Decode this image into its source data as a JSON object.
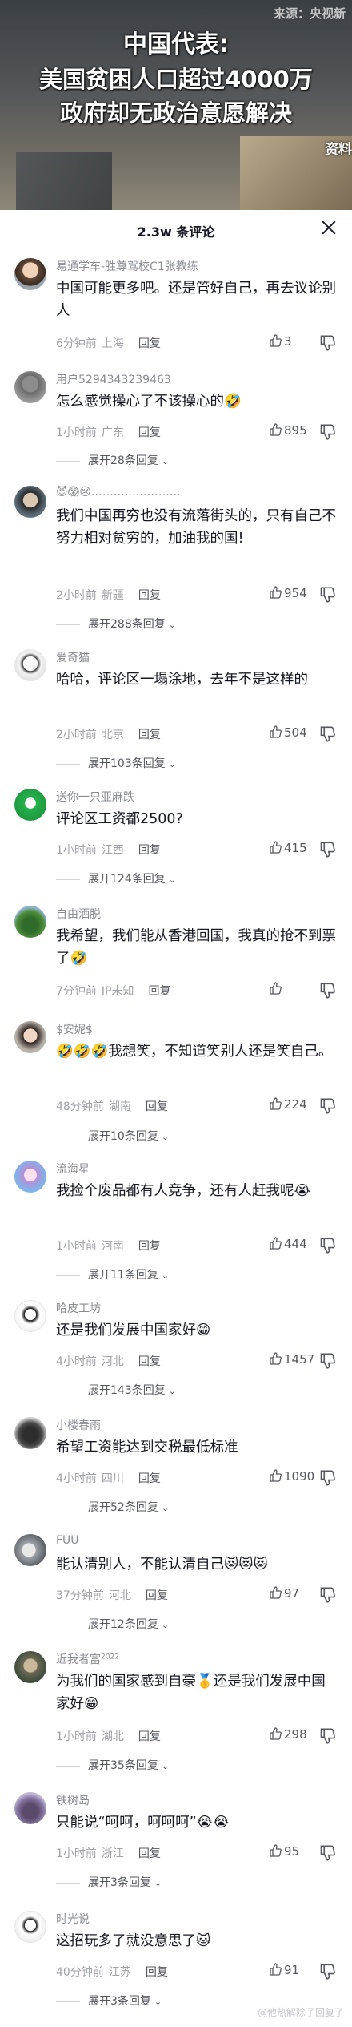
{
  "video": {
    "source": "来源：央视新",
    "headline_1": "中国代表:",
    "headline_2": "美国贫困人口超过4000万",
    "headline_3": "政府却无政治意愿解决",
    "side_tag": "资料"
  },
  "panel": {
    "title": "2.3w 条评论"
  },
  "comments": [
    {
      "user": "易通学车-胜尊驾校C1张教练",
      "text": "中国可能更多吧。还是管好自己，再去议论别人",
      "time": "6分钟前",
      "location": "上海",
      "reply": "回复",
      "likes": "3",
      "expand": ""
    },
    {
      "user": "用户5294343239463",
      "text": "怎么感觉操心了不该操心的🤣",
      "time": "1小时前",
      "location": "广东",
      "reply": "回复",
      "likes": "895",
      "expand": "展开28条回复"
    },
    {
      "user": "😈😱😢……………………",
      "text": "我们中国再穷也没有流落街头的，只有自己不努力相对贫穷的，加油我的国!",
      "time": "2小时前",
      "location": "新疆",
      "reply": "回复",
      "likes": "954",
      "expand": "展开288条回复"
    },
    {
      "user": "爱奇猫",
      "text": "哈哈，评论区一塌涂地，去年不是这样的",
      "time": "2小时前",
      "location": "北京",
      "reply": "回复",
      "likes": "504",
      "expand": "展开103条回复"
    },
    {
      "user": "送你一只亚麻跌",
      "text": "评论区工资都2500?",
      "time": "1小时前",
      "location": "江西",
      "reply": "回复",
      "likes": "415",
      "expand": "展开124条回复"
    },
    {
      "user": "自由洒脱",
      "text": "我希望，我们能从香港回国，我真的抢不到票了🤣",
      "time": "7分钟前",
      "location": "IP未知",
      "reply": "回复",
      "likes": "",
      "expand": ""
    },
    {
      "user": "$安妮$",
      "text": "🤣🤣🤣我想笑，不知道笑别人还是笑自己。",
      "time": "48分钟前",
      "location": "湖南",
      "reply": "回复",
      "likes": "224",
      "expand": "展开10条回复"
    },
    {
      "user": "流海星",
      "text": "我捡个废品都有人竞争，还有人赶我呢😭",
      "time": "1小时前",
      "location": "河南",
      "reply": "回复",
      "likes": "444",
      "expand": "展开11条回复"
    },
    {
      "user": "哈皮工坊",
      "text": "还是我们发展中国家好😁",
      "time": "4小时前",
      "location": "河北",
      "reply": "回复",
      "likes": "1457",
      "expand": "展开143条回复"
    },
    {
      "user": "小楼春雨",
      "text": "希望工资能达到交税最低标准",
      "time": "4小时前",
      "location": "四川",
      "reply": "回复",
      "likes": "1090",
      "expand": "展开52条回复"
    },
    {
      "user": "FUU",
      "text": "能认清别人，不能认清自己😻😻😻",
      "time": "37分钟前",
      "location": "河北",
      "reply": "回复",
      "likes": "97",
      "expand": "展开12条回复"
    },
    {
      "user": "近我者富",
      "user_sup": "2022",
      "text": "为我们的国家感到自豪🥇还是我们发展中国家好😁",
      "time": "1小时前",
      "location": "湖北",
      "reply": "回复",
      "likes": "298",
      "expand": "展开35条回复"
    },
    {
      "user": "铁树岛",
      "text": "只能说“呵呵，呵呵呵”😭😭",
      "time": "1小时前",
      "location": "浙江",
      "reply": "回复",
      "likes": "95",
      "expand": "展开3条回复"
    },
    {
      "user": "时光说",
      "text": "这招玩多了就没意思了🐱",
      "time": "40分钟前",
      "location": "江苏",
      "reply": "回复",
      "likes": "91",
      "expand": "展开3条回复"
    }
  ],
  "watermark": "@他热解除了回复了",
  "colors": {
    "text": "#161823",
    "meta": "#a1a2a7",
    "username": "#8a8b91"
  }
}
